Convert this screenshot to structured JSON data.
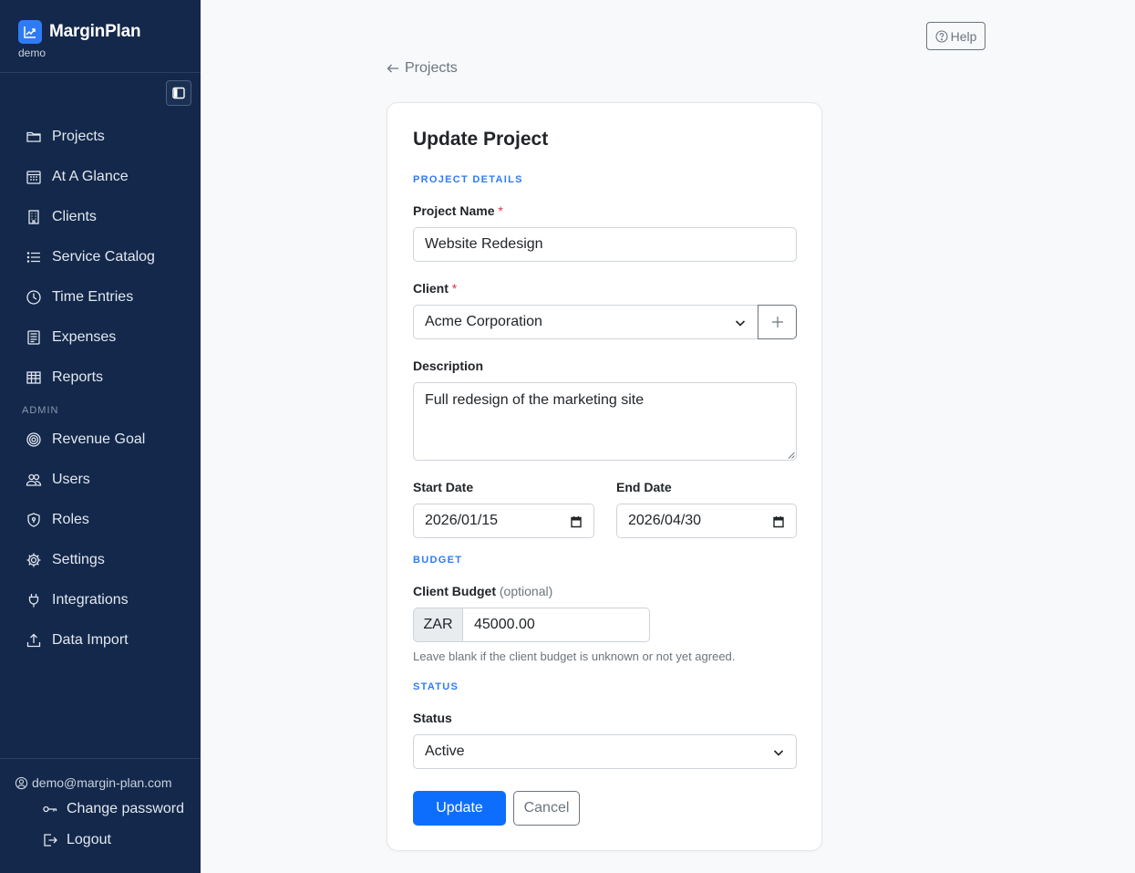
{
  "app": {
    "name": "MarginPlan",
    "workspace": "demo"
  },
  "sidebar": {
    "items": [
      {
        "label": "Projects",
        "icon": "folder-icon"
      },
      {
        "label": "At A Glance",
        "icon": "calendar-icon"
      },
      {
        "label": "Clients",
        "icon": "building-icon"
      },
      {
        "label": "Service Catalog",
        "icon": "list-icon"
      },
      {
        "label": "Time Entries",
        "icon": "clock-icon"
      },
      {
        "label": "Expenses",
        "icon": "receipt-icon"
      },
      {
        "label": "Reports",
        "icon": "table-icon"
      }
    ],
    "admin_heading": "ADMIN",
    "admin_items": [
      {
        "label": "Revenue Goal",
        "icon": "target-icon"
      },
      {
        "label": "Users",
        "icon": "users-icon"
      },
      {
        "label": "Roles",
        "icon": "shield-icon"
      },
      {
        "label": "Settings",
        "icon": "gear-icon"
      },
      {
        "label": "Integrations",
        "icon": "plug-icon"
      },
      {
        "label": "Data Import",
        "icon": "upload-icon"
      }
    ],
    "user_email": "demo@margin-plan.com",
    "change_password": "Change password",
    "logout": "Logout"
  },
  "header": {
    "help_label": "Help",
    "back_label": "Projects"
  },
  "form": {
    "title": "Update Project",
    "sections": {
      "details": "PROJECT DETAILS",
      "budget": "BUDGET",
      "status": "STATUS"
    },
    "project_name": {
      "label": "Project Name",
      "required_mark": "*",
      "value": "Website Redesign"
    },
    "client": {
      "label": "Client",
      "required_mark": "*",
      "value": "Acme Corporation"
    },
    "description": {
      "label": "Description",
      "value": "Full redesign of the marketing site"
    },
    "start_date": {
      "label": "Start Date",
      "value": "2026/01/15"
    },
    "end_date": {
      "label": "End Date",
      "value": "2026/04/30"
    },
    "client_budget": {
      "label": "Client Budget",
      "optional": "(optional)",
      "currency": "ZAR",
      "value": "45000.00",
      "hint": "Leave blank if the client budget is unknown or not yet agreed."
    },
    "status": {
      "label": "Status",
      "value": "Active"
    },
    "update_label": "Update",
    "cancel_label": "Cancel"
  },
  "colors": {
    "sidebar_bg": "#13284a",
    "accent": "#0d6efd",
    "section_heading": "#2f7bf6",
    "required": "#dc3545"
  }
}
